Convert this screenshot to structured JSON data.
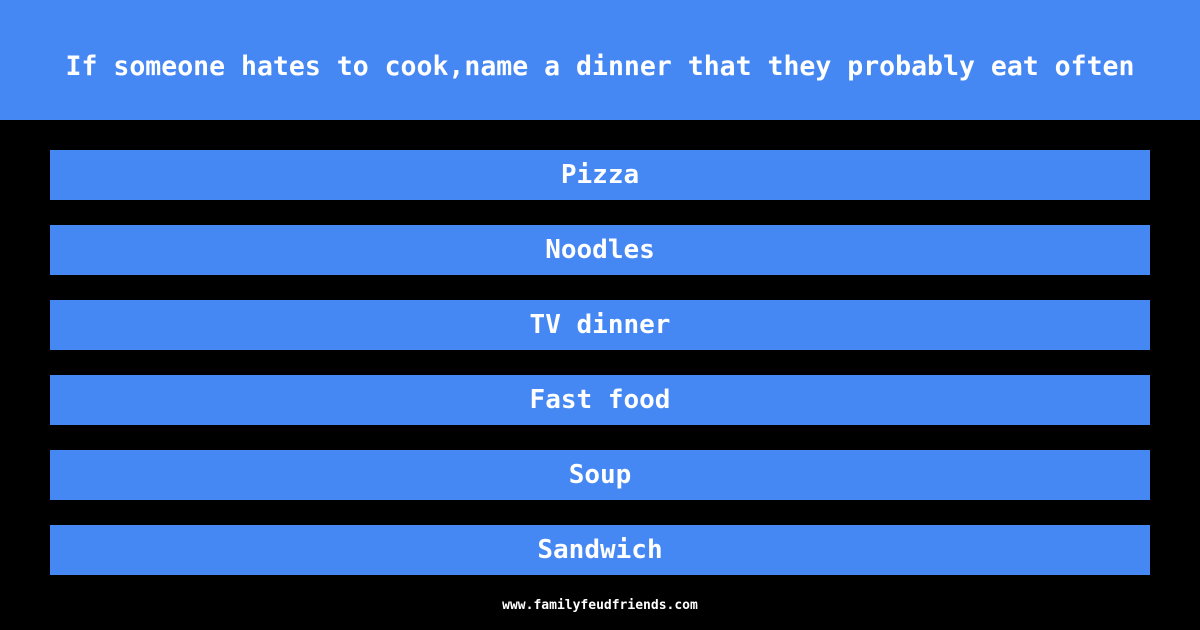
{
  "question": "If someone hates to cook,name a dinner that they probably eat often",
  "answers": [
    {
      "label": "Pizza"
    },
    {
      "label": "Noodles"
    },
    {
      "label": "TV dinner"
    },
    {
      "label": "Fast food"
    },
    {
      "label": "Soup"
    },
    {
      "label": "Sandwich"
    }
  ],
  "footer": {
    "site": "www.familyfeudfriends.com"
  },
  "colors": {
    "accent": "#4587f3",
    "background": "#000000",
    "text": "#ffffff"
  }
}
